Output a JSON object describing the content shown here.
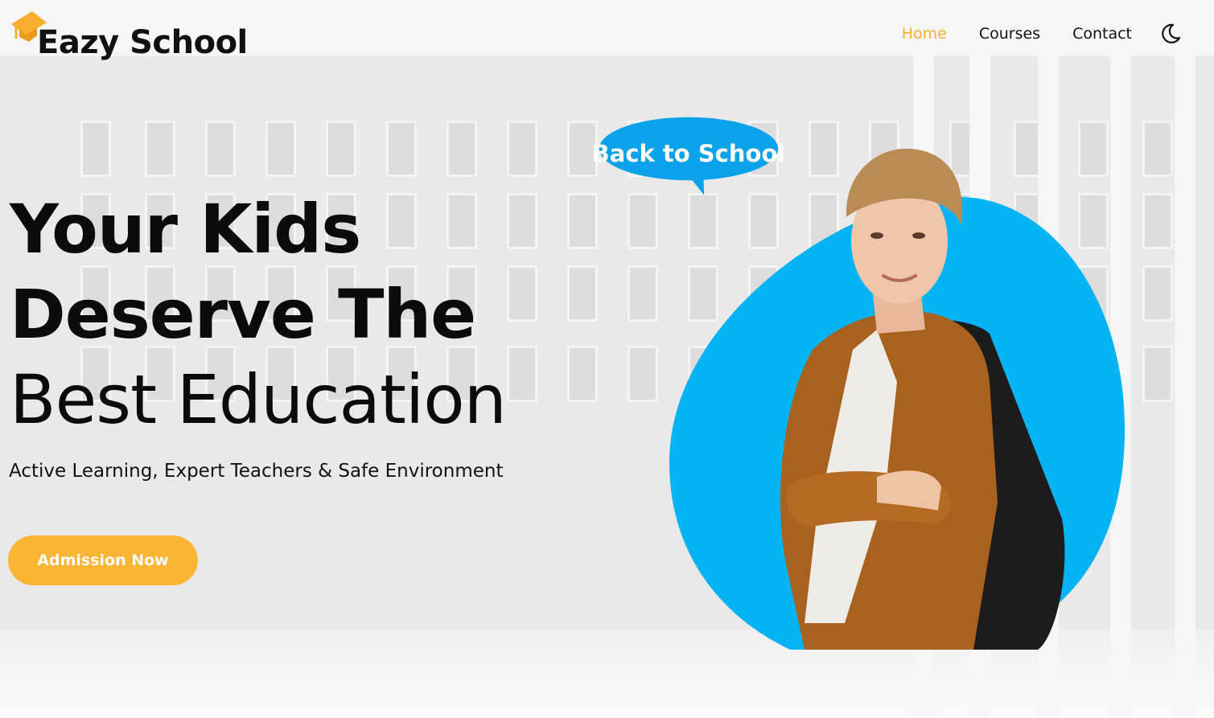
{
  "brand": {
    "name": "Eazy School",
    "logo_icon": "graduation-cap-icon",
    "accent_color": "#f8ae30"
  },
  "nav": {
    "items": [
      {
        "label": "Home",
        "active": true
      },
      {
        "label": "Courses",
        "active": false
      },
      {
        "label": "Contact",
        "active": false
      }
    ],
    "theme_toggle_icon": "moon-icon"
  },
  "hero": {
    "title_line1": "Your Kids",
    "title_line2": "Deserve The",
    "title_line3": "Best Education",
    "subtitle": "Active Learning, Expert Teachers & Safe Environment",
    "cta_label": "Admission Now",
    "cta_color": "#fbb534",
    "bubble_text": "Back to School",
    "bubble_color": "#0aa2ea",
    "blob_color": "#04b3f3"
  }
}
